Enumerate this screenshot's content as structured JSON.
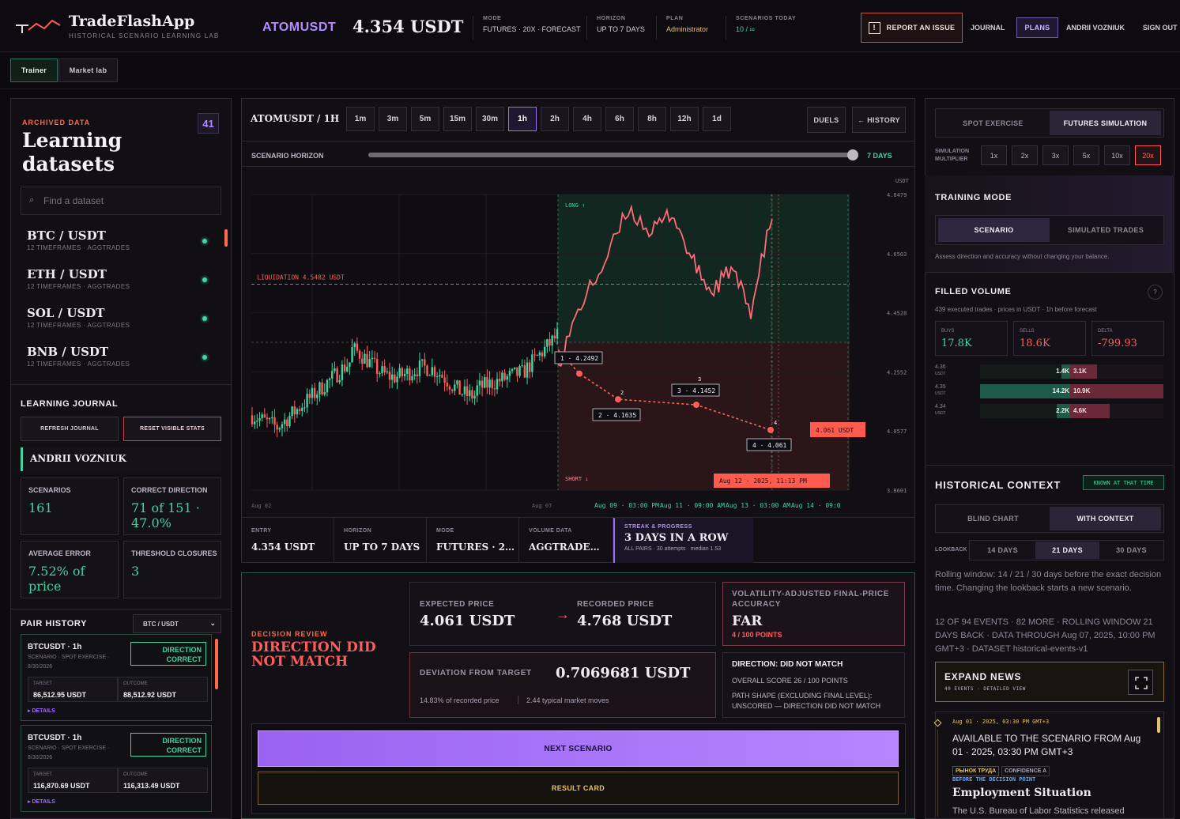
{
  "app": {
    "name": "TradeFlashApp",
    "tagline": "HISTORICAL SCENARIO LEARNING LAB"
  },
  "header": {
    "symbol": "ATOMUSDT",
    "price": "4.354 USDT",
    "meta": [
      {
        "k": "MODE",
        "v": "FUTURES · 20x · FORECAST"
      },
      {
        "k": "HORIZON",
        "v": "UP TO 7 DAYS"
      },
      {
        "k": "PLAN",
        "v": "Administrator"
      },
      {
        "k": "SCENARIOS TODAY",
        "v": "10 / ∞"
      }
    ],
    "report": "REPORT AN ISSUE",
    "journal": "JOURNAL",
    "plans": "PLANS",
    "user": "ANDRII VOZNIUK",
    "signout": "SIGN OUT"
  },
  "tabs": {
    "trainer": "Trainer",
    "market_lab": "Market lab"
  },
  "sidebar": {
    "kicker": "ARCHIVED DATA",
    "count": "41",
    "title_1": "Learning",
    "title_2": "datasets",
    "search_placeholder": "Find a dataset",
    "pairs": [
      {
        "name": "BTC / USDT",
        "sub": "12 TIMEFRAMES · AGGTRADES"
      },
      {
        "name": "ETH / USDT",
        "sub": "12 TIMEFRAMES · AGGTRADES"
      },
      {
        "name": "SOL / USDT",
        "sub": "12 TIMEFRAMES · AGGTRADES"
      },
      {
        "name": "BNB / USDT",
        "sub": "12 TIMEFRAMES · AGGTRADES"
      }
    ],
    "journal": {
      "title": "LEARNING JOURNAL",
      "refresh": "REFRESH JOURNAL",
      "reset": "RESET VISIBLE STATS",
      "user": "ANDRII VOZNIUK",
      "stats": [
        {
          "k": "SCENARIOS",
          "v": "161"
        },
        {
          "k": "CORRECT DIRECTION",
          "v": "71 of 151 · 47.0%"
        },
        {
          "k": "AVERAGE ERROR",
          "v": "7.52% of price"
        },
        {
          "k": "THRESHOLD CLOSURES",
          "v": "3"
        }
      ]
    },
    "history": {
      "title": "PAIR HISTORY",
      "filter": "BTC / USDT",
      "cards": [
        {
          "title": "BTCUSDT · 1h",
          "sub1": "SCENARIO · SPOT EXERCISE ·",
          "sub2": "8/30/2026",
          "badge": "DIRECTION CORRECT",
          "target_k": "TARGET",
          "target": "86,512.95 USDT",
          "outcome_k": "OUTCOME",
          "outcome": "88,512.92 USDT",
          "details": "▸ DETAILS"
        },
        {
          "title": "BTCUSDT · 1h",
          "sub1": "SCENARIO · SPOT EXERCISE ·",
          "sub2": "8/30/2026",
          "badge": "DIRECTION CORRECT",
          "target_k": "TARGET",
          "target": "116,870.69 USDT",
          "outcome_k": "OUTCOME",
          "outcome": "116,313.49 USDT",
          "details": "▸ DETAILS"
        }
      ]
    }
  },
  "chart_panel": {
    "pair_tf": "ATOMUSDT / 1H",
    "timeframes": [
      "1m",
      "3m",
      "5m",
      "15m",
      "30m",
      "1h",
      "2h",
      "4h",
      "6h",
      "8h",
      "12h",
      "1d"
    ],
    "active_tf": "1h",
    "duels": "DUELS",
    "history": "← HISTORY",
    "horizon_label": "SCENARIO HORIZON",
    "horizon_value": "7 DAYS",
    "slider": 1.0,
    "summary": [
      {
        "k": "ENTRY",
        "v": "4.354 USDT"
      },
      {
        "k": "HORIZON",
        "v": "UP TO 7 DAYS"
      },
      {
        "k": "MODE",
        "v": "FUTURES · 2…"
      },
      {
        "k": "VOLUME DATA",
        "v": "AGGTRADE…"
      }
    ],
    "streak": {
      "k": "STREAK & PROGRESS",
      "v": "3 DAYS IN A ROW",
      "s": "ALL PAIRS · 30 attempts · median 1.53"
    }
  },
  "chart_data": {
    "type": "candlestick",
    "yunit": "USDT",
    "yticks": [
      "4.8479",
      "4.6503",
      "4.4528",
      "4.2552",
      "4.0577",
      "3.8601"
    ],
    "xticks": [
      "Aug 02",
      "Aug 07",
      "Aug 09 · 03:00 PM",
      "Aug 11 · 09:00 AM",
      "Aug 13 · 03:00 AM",
      "Aug 14 · 09:0"
    ],
    "ylim": [
      3.8601,
      4.8479
    ],
    "zones": {
      "long": "LONG ↑",
      "short": "SHORT ↓"
    },
    "liquidation": {
      "label": "LIQUIDATION 4.5482 USDT",
      "value": 4.5482
    },
    "forecast_points": [
      {
        "label": "1 · 4.2492",
        "value": 4.2492
      },
      {
        "label": "2 · 4.1635",
        "value": 4.1635
      },
      {
        "label": "3 · 4.1452",
        "value": 4.1452
      },
      {
        "label": "4 · 4.061",
        "value": 4.061
      }
    ],
    "point_numbers": [
      "2",
      "3",
      "4"
    ],
    "target_badge": "4.061 USDT",
    "time_badge": "Aug 12 · 2025, 11:13 PM"
  },
  "review": {
    "kicker": "DECISION REVIEW",
    "title": "DIRECTION DID NOT MATCH",
    "expected_k": "EXPECTED PRICE",
    "expected": "4.061 USDT",
    "arrow": "→",
    "recorded_k": "RECORDED PRICE",
    "recorded": "4.768 USDT",
    "accuracy_k": "VOLATILITY-ADJUSTED FINAL-PRICE ACCURACY",
    "accuracy": "FAR",
    "accuracy_pts": "4 / 100 POINTS",
    "deviation_k": "DEVIATION FROM TARGET",
    "deviation": "0.7069681 USDT",
    "dev_sub1": "14.83% of recorded price",
    "dev_sub2": "2.44 typical market moves",
    "dir": "DIRECTION: DID NOT MATCH",
    "score": "OVERALL SCORE 26 / 100 POINTS",
    "path": "PATH SHAPE (EXCLUDING FINAL LEVEL): UNSCORED — DIRECTION DID NOT MATCH",
    "next": "NEXT SCENARIO",
    "result": "RESULT CARD"
  },
  "right": {
    "spot": "SPOT EXERCISE",
    "futures": "FUTURES SIMULATION",
    "mult_label": "SIMULATION MULTIPLIER",
    "mults": [
      "1x",
      "2x",
      "3x",
      "5x",
      "10x",
      "20x"
    ],
    "active_mult": "20x",
    "training_title": "TRAINING MODE",
    "scenario": "SCENARIO",
    "simulated": "SIMULATED TRADES",
    "training_desc": "Assess direction and accuracy without changing your balance.",
    "volume_title": "FILLED VOLUME",
    "help": "?",
    "volume_desc": "439 executed trades · prices in USDT · 1h before forecast",
    "buys_k": "BUYS",
    "buys": "17.8K",
    "sells_k": "SELLS",
    "sells": "18.6K",
    "delta_k": "DELTA",
    "delta": "-799.93",
    "ladder": [
      {
        "price": "4.36",
        "unit": "USDT",
        "buy": "1.4K",
        "sell": "3.1K",
        "bfrac": 0.1,
        "sfrac": 0.29
      },
      {
        "price": "4.35",
        "unit": "USDT",
        "buy": "14.2K",
        "sell": "10.9K",
        "bfrac": 1.0,
        "sfrac": 1.0
      },
      {
        "price": "4.34",
        "unit": "USDT",
        "buy": "2.2K",
        "sell": "4.6K",
        "bfrac": 0.15,
        "sfrac": 0.42
      }
    ],
    "hist_title": "HISTORICAL CONTEXT",
    "known": "KNOWN AT THAT TIME",
    "blind": "BLIND CHART",
    "with_ctx": "WITH CONTEXT",
    "lookback": "LOOKBACK",
    "lb": [
      "14 DAYS",
      "21 DAYS",
      "30 DAYS"
    ],
    "lb_active": "21 DAYS",
    "rolling": "Rolling window: 14 / 21 / 30 days before the exact decision time. Changing the lookback starts a new scenario.",
    "events_info": "12 OF 94 EVENTS · 82 MORE · ROLLING WINDOW 21 DAYS BACK · DATA THROUGH Aug 07, 2025, 10:00 PM GMT+3 · DATASET historical-events-v1",
    "expand": "EXPAND NEWS",
    "expand_sub": "40 EVENTS · DETAILED VIEW",
    "news": {
      "time": "Aug 01 · 2025, 03:30 PM GMT+3",
      "avail": "AVAILABLE TO THE SCENARIO FROM Aug 01 · 2025, 03:30 PM GMT+3",
      "chip1": "РЫНОК ТРУДА",
      "chip2": "CONFIDENCE A",
      "before": "BEFORE THE DECISION POINT",
      "headline": "Employment Situation",
      "body": "The U.S. Bureau of Labor Statistics released"
    }
  },
  "colors": {
    "accent": "#9d6bff",
    "green": "#3fd6a0",
    "red": "#ff5c5c",
    "gold": "#e4c06a"
  }
}
